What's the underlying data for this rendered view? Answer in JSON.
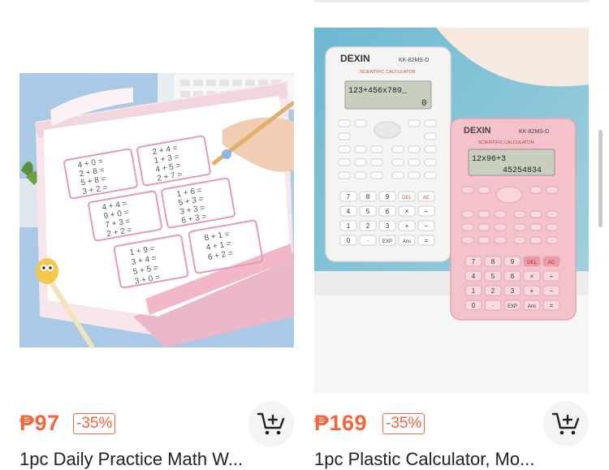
{
  "products": [
    {
      "price": "₱97",
      "discount": "-35%",
      "title": "1pc Daily Practice Math W...",
      "image": {
        "math_lines": [
          "4 + 0 =",
          "2 + 8 =",
          "5 + 8 =",
          "3 + 2 =",
          "2 + 4 =",
          "1 + 3 =",
          "4 + 5 =",
          "2 + 7 =",
          "4 + 4 =",
          "9 + 0 =",
          "7 + 3 =",
          "2 + 2 =",
          "1 + 6 =",
          "5 + 3 =",
          "3 + 3 =",
          "6 + 3 =",
          "1 + 9 =",
          "3 + 4 =",
          "5 + 5 =",
          "3 + 0 =",
          "8 + 1 =",
          "4 + 1 =",
          "6 + 2 ="
        ]
      }
    },
    {
      "price": "₱169",
      "discount": "-35%",
      "title": "1pc Plastic Calculator, Mo...",
      "image": {
        "brand": "DEXIN",
        "model": "KK-82MS-D",
        "subtitle": "SCIENTIFIC CALCULATOR",
        "white_display_top": "123+456x789_",
        "white_display_bottom": "0",
        "pink_display_top": "12x96+3",
        "pink_display_bottom": "45254834",
        "keys": [
          "7",
          "8",
          "9",
          "DEL",
          "AC",
          "4",
          "5",
          "6",
          "×",
          "÷",
          "1",
          "2",
          "3",
          "+",
          "−",
          "0",
          "·",
          "EXP",
          "Ans",
          "="
        ]
      }
    }
  ],
  "colors": {
    "price": "#fa6338",
    "white_calc": "#f4f4f2",
    "pink_calc": "#f3c2cb",
    "screen": "#c9cfbf"
  }
}
